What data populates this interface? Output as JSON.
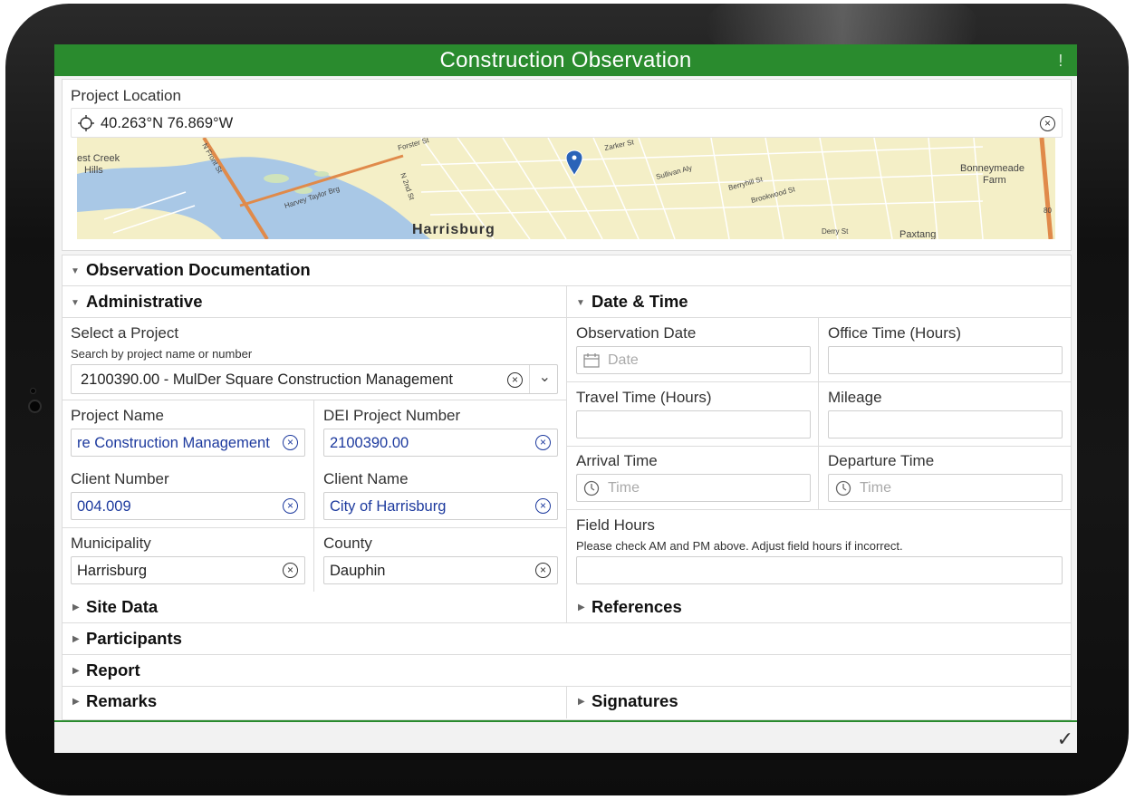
{
  "app": {
    "title": "Construction Observation",
    "warning_icon": "!"
  },
  "location": {
    "label": "Project Location",
    "coordinates": "40.263°N 76.869°W",
    "map": {
      "city_label": "Harrisburg",
      "labels": [
        "est Creek Hills",
        "Bonneymeade Farm",
        "Paxtang",
        "Harvey Taylor Brg",
        "N Front St",
        "Forster St",
        "N 2nd St",
        "Zarker St",
        "Sullivan Aly",
        "Berryhill St",
        "Brookwood St",
        "Derry St",
        "80"
      ]
    }
  },
  "observation_section": "Observation Documentation",
  "administrative": {
    "title": "Administrative",
    "select_project": {
      "label": "Select a Project",
      "hint": "Search by project name or number",
      "value": "2100390.00 - MulDer Square Construction Management"
    },
    "project_name": {
      "label": "Project Name",
      "value": "re Construction Management"
    },
    "dei_project_number": {
      "label": "DEI Project Number",
      "value": "2100390.00"
    },
    "client_number": {
      "label": "Client Number",
      "value": "004.009"
    },
    "client_name": {
      "label": "Client Name",
      "value": "City of Harrisburg"
    },
    "municipality": {
      "label": "Municipality",
      "value": "Harrisburg"
    },
    "county": {
      "label": "County",
      "value": "Dauphin"
    }
  },
  "date_time": {
    "title": "Date & Time",
    "observation_date": {
      "label": "Observation Date",
      "placeholder": "Date"
    },
    "office_time": {
      "label": "Office Time (Hours)",
      "value": ""
    },
    "travel_time": {
      "label": "Travel Time (Hours)",
      "value": ""
    },
    "mileage": {
      "label": "Mileage",
      "value": ""
    },
    "arrival_time": {
      "label": "Arrival Time",
      "placeholder": "Time"
    },
    "departure_time": {
      "label": "Departure Time",
      "placeholder": "Time"
    },
    "field_hours": {
      "label": "Field Hours",
      "hint": "Please check AM and PM above. Adjust field hours if incorrect.",
      "value": ""
    }
  },
  "collapsed_sections": {
    "site_data": "Site Data",
    "references": "References",
    "participants": "Participants",
    "report": "Report",
    "remarks": "Remarks",
    "signatures": "Signatures"
  },
  "colors": {
    "accent": "#2a8b2e",
    "link_text": "#1d3a9e",
    "water": "#a7c6e5",
    "land": "#f5f0c8"
  }
}
